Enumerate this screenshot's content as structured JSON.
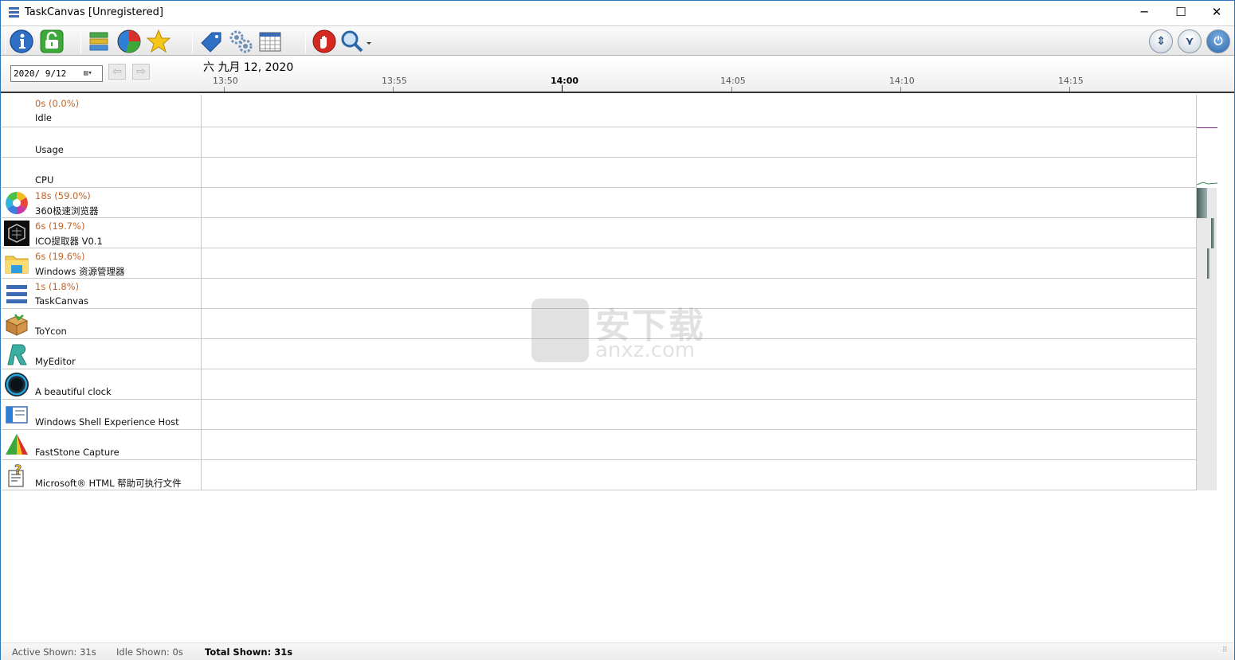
{
  "window": {
    "title": "TaskCanvas [Unregistered]",
    "minimize": "─",
    "maximize": "☐",
    "close": "✕"
  },
  "toolbar": {
    "buttons": [
      {
        "name": "info",
        "icon": "info-icon"
      },
      {
        "name": "unlock",
        "icon": "unlock-icon"
      },
      {
        "name": "layers",
        "icon": "layers-icon"
      },
      {
        "name": "pie-chart",
        "icon": "pie-chart-icon"
      },
      {
        "name": "favorite",
        "icon": "star-icon"
      },
      {
        "name": "tag",
        "icon": "tag-icon"
      },
      {
        "name": "settings",
        "icon": "gears-icon"
      },
      {
        "name": "calendar",
        "icon": "calendar-icon"
      },
      {
        "name": "stop",
        "icon": "stop-hand-icon"
      },
      {
        "name": "search",
        "icon": "magnifier-icon"
      }
    ],
    "right_buttons": [
      {
        "name": "sort",
        "glyph": "⇕"
      },
      {
        "name": "collapse",
        "glyph": "⋎"
      },
      {
        "name": "power",
        "glyph": "⏻"
      }
    ]
  },
  "datebar": {
    "date_value": "2020/ 9/12",
    "dropdown_glyph": "▤▾",
    "prev_glyph": "⇦",
    "next_glyph": "⇨",
    "current_date": "六 九月 12, 2020",
    "ticks": [
      "13:50",
      "13:55",
      "14:00",
      "14:05",
      "14:10",
      "14:15"
    ]
  },
  "rows": [
    {
      "stat": "0s (0.0%)",
      "name": "Idle",
      "icon": "none",
      "recent_usage": 0
    },
    {
      "stat": "",
      "name": "Usage",
      "icon": "none",
      "recent_usage": 0
    },
    {
      "stat": "",
      "name": "CPU",
      "icon": "none",
      "recent_usage": 0
    },
    {
      "stat": "18s (59.0%)",
      "name": "360极速浏览器",
      "icon": "browser-360-icon",
      "recent_usage": 0.59
    },
    {
      "stat": "6s (19.7%)",
      "name": "ICO提取器 V0.1",
      "icon": "ico-extractor-icon",
      "recent_usage": 0.197
    },
    {
      "stat": "6s (19.6%)",
      "name": "Windows 资源管理器",
      "icon": "folder-icon",
      "recent_usage": 0.196
    },
    {
      "stat": "1s (1.8%)",
      "name": "TaskCanvas",
      "icon": "taskcanvas-icon",
      "recent_usage": 0.018
    },
    {
      "stat": "",
      "name": "ToYcon",
      "icon": "box-icon",
      "recent_usage": 0
    },
    {
      "stat": "",
      "name": "MyEditor",
      "icon": "editor-r-icon",
      "recent_usage": 0
    },
    {
      "stat": "",
      "name": "A beautiful clock",
      "icon": "clock-icon",
      "recent_usage": 0
    },
    {
      "stat": "",
      "name": "Windows Shell Experience Host",
      "icon": "window-icon",
      "recent_usage": 0
    },
    {
      "stat": "",
      "name": "FastStone Capture",
      "icon": "faststone-icon",
      "recent_usage": 0
    },
    {
      "stat": "",
      "name": "Microsoft® HTML 帮助可执行文件",
      "icon": "help-file-icon",
      "recent_usage": 0
    }
  ],
  "watermark": {
    "line1": "安下载",
    "line2": "anxz.com"
  },
  "status": {
    "active": "Active Shown: 31s",
    "idle": "Idle Shown: 0s",
    "total": "Total Shown: 31s"
  },
  "colors": {
    "stat_text": "#c0642b",
    "usage_line": "#7a2a7a",
    "cpu_line": "#2e8b57",
    "window_border": "#2b78c2"
  }
}
